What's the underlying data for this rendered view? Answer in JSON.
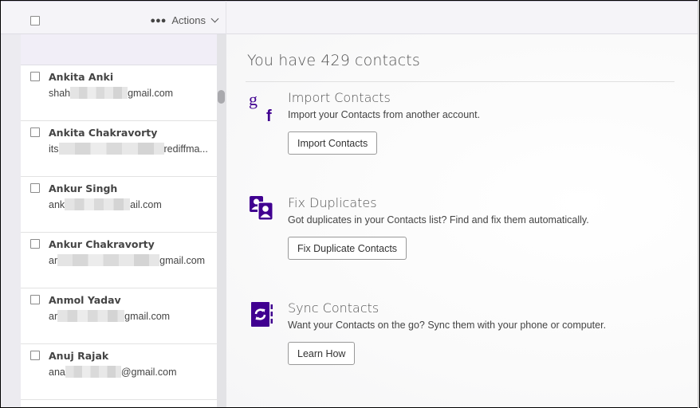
{
  "list_header": {
    "actions_label": "Actions",
    "more_icon": "ellipsis-icon",
    "dropdown_icon": "chevron-down-icon"
  },
  "contacts": [
    {
      "name": "Ankita Anki",
      "email_prefix": "shah",
      "email_suffix": "gmail.com",
      "blur_width": 72
    },
    {
      "name": "Ankita Chakravorty",
      "email_prefix": "its",
      "email_suffix": "rediffma...",
      "blur_width": 132
    },
    {
      "name": "Ankur Singh",
      "email_prefix": "ank",
      "email_suffix": "ail.com",
      "blur_width": 82
    },
    {
      "name": "Ankur Chakravorty",
      "email_prefix": "ar",
      "email_suffix": "gmail.com",
      "blur_width": 128
    },
    {
      "name": "Anmol Yadav",
      "email_prefix": "ar",
      "email_suffix": "gmail.com",
      "blur_width": 84
    },
    {
      "name": "Anuj Rajak",
      "email_prefix": "ana",
      "email_suffix": "@gmail.com",
      "blur_width": 70
    }
  ],
  "main": {
    "title": "You have 429 contacts",
    "sections": [
      {
        "icon": "google-facebook-icon",
        "title": "Import Contacts",
        "description": "Import your Contacts from another account.",
        "button": "Import Contacts"
      },
      {
        "icon": "duplicate-contacts-icon",
        "title": "Fix Duplicates",
        "description": "Got duplicates in your Contacts list? Find and fix them automatically.",
        "button": "Fix Duplicate Contacts"
      },
      {
        "icon": "sync-contacts-icon",
        "title": "Sync Contacts",
        "description": "Want your Contacts on the go? Sync them with your phone or computer.",
        "button": "Learn How"
      }
    ]
  },
  "colors": {
    "accent_purple": "#400090",
    "header_bg": "#f5f4f8",
    "banner_bg": "#f1eef7"
  }
}
